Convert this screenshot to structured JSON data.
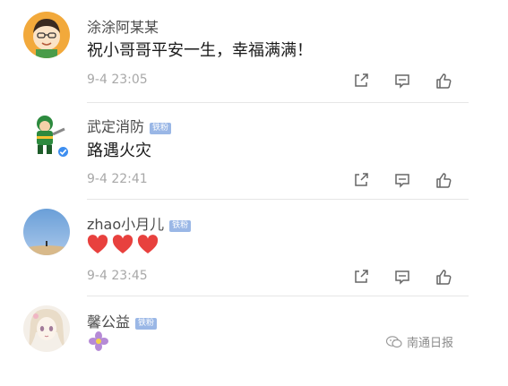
{
  "comments": [
    {
      "username": "涂涂阿某某",
      "content": "祝小哥哥平安一生，幸福满满！",
      "timestamp": "9-4 23:05"
    },
    {
      "username": "武定消防",
      "badge": "铁粉",
      "content": "路遇火灾",
      "timestamp": "9-4 22:41",
      "verified": true
    },
    {
      "username": "zhao小月儿",
      "badge": "铁粉",
      "content_emojis": [
        "red-heart",
        "red-heart",
        "red-heart"
      ],
      "timestamp": "9-4 23:45"
    },
    {
      "username": "馨公益",
      "badge": "铁粉",
      "content_emojis": [
        "purple-flower"
      ]
    }
  ],
  "actions": [
    "share-icon",
    "comment-icon",
    "like-icon"
  ],
  "watermark": {
    "text": "南通日报",
    "icon": "wechat-icon"
  },
  "colors": {
    "badge": "#9ab7e6",
    "verified": "#3d8ef0",
    "heart": "#e8413e"
  }
}
